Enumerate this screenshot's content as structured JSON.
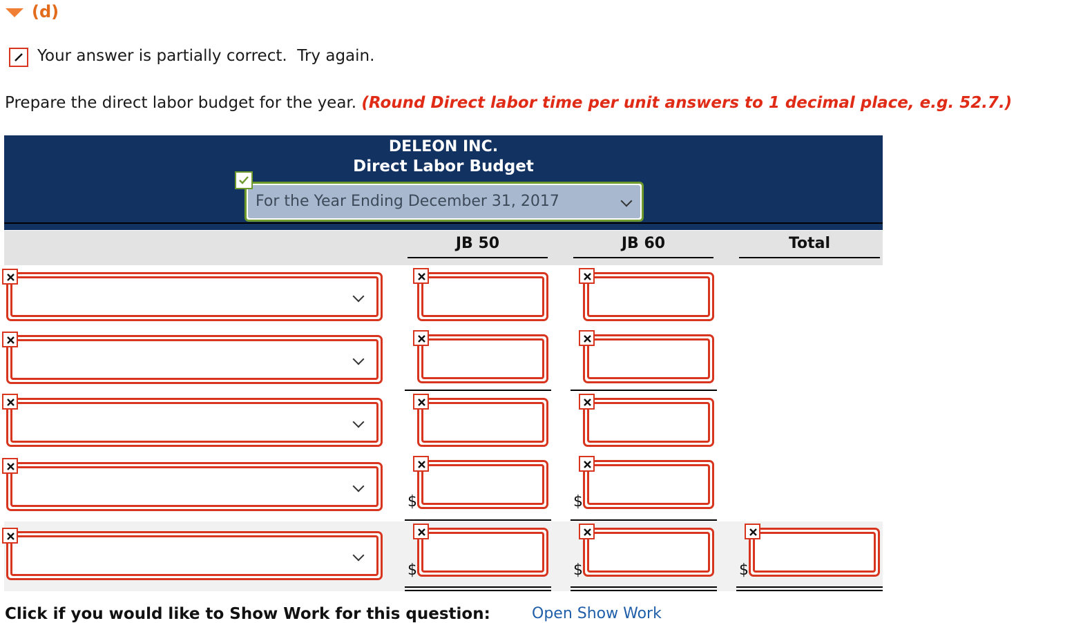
{
  "section": {
    "label": "(d)"
  },
  "feedback": {
    "text": "Your answer is partially correct.  Try again."
  },
  "instruction": {
    "text": "Prepare the direct labor budget for the year. ",
    "hint": "(Round Direct labor time per unit answers to 1 decimal place, e.g. 52.7.)"
  },
  "table": {
    "company": "DELEON INC.",
    "title": "Direct Labor Budget",
    "period": "For the Year Ending December 31, 2017",
    "columns": [
      "JB 50",
      "JB 60",
      "Total"
    ],
    "currency": "$"
  },
  "footer": {
    "show_work": "Click if you would like to Show Work for this question:",
    "link": "Open Show Work"
  },
  "colors": {
    "error": "#d8351e",
    "header_bg": "#123361",
    "correct": "#6e9a2d",
    "hint": "#e02b16"
  }
}
